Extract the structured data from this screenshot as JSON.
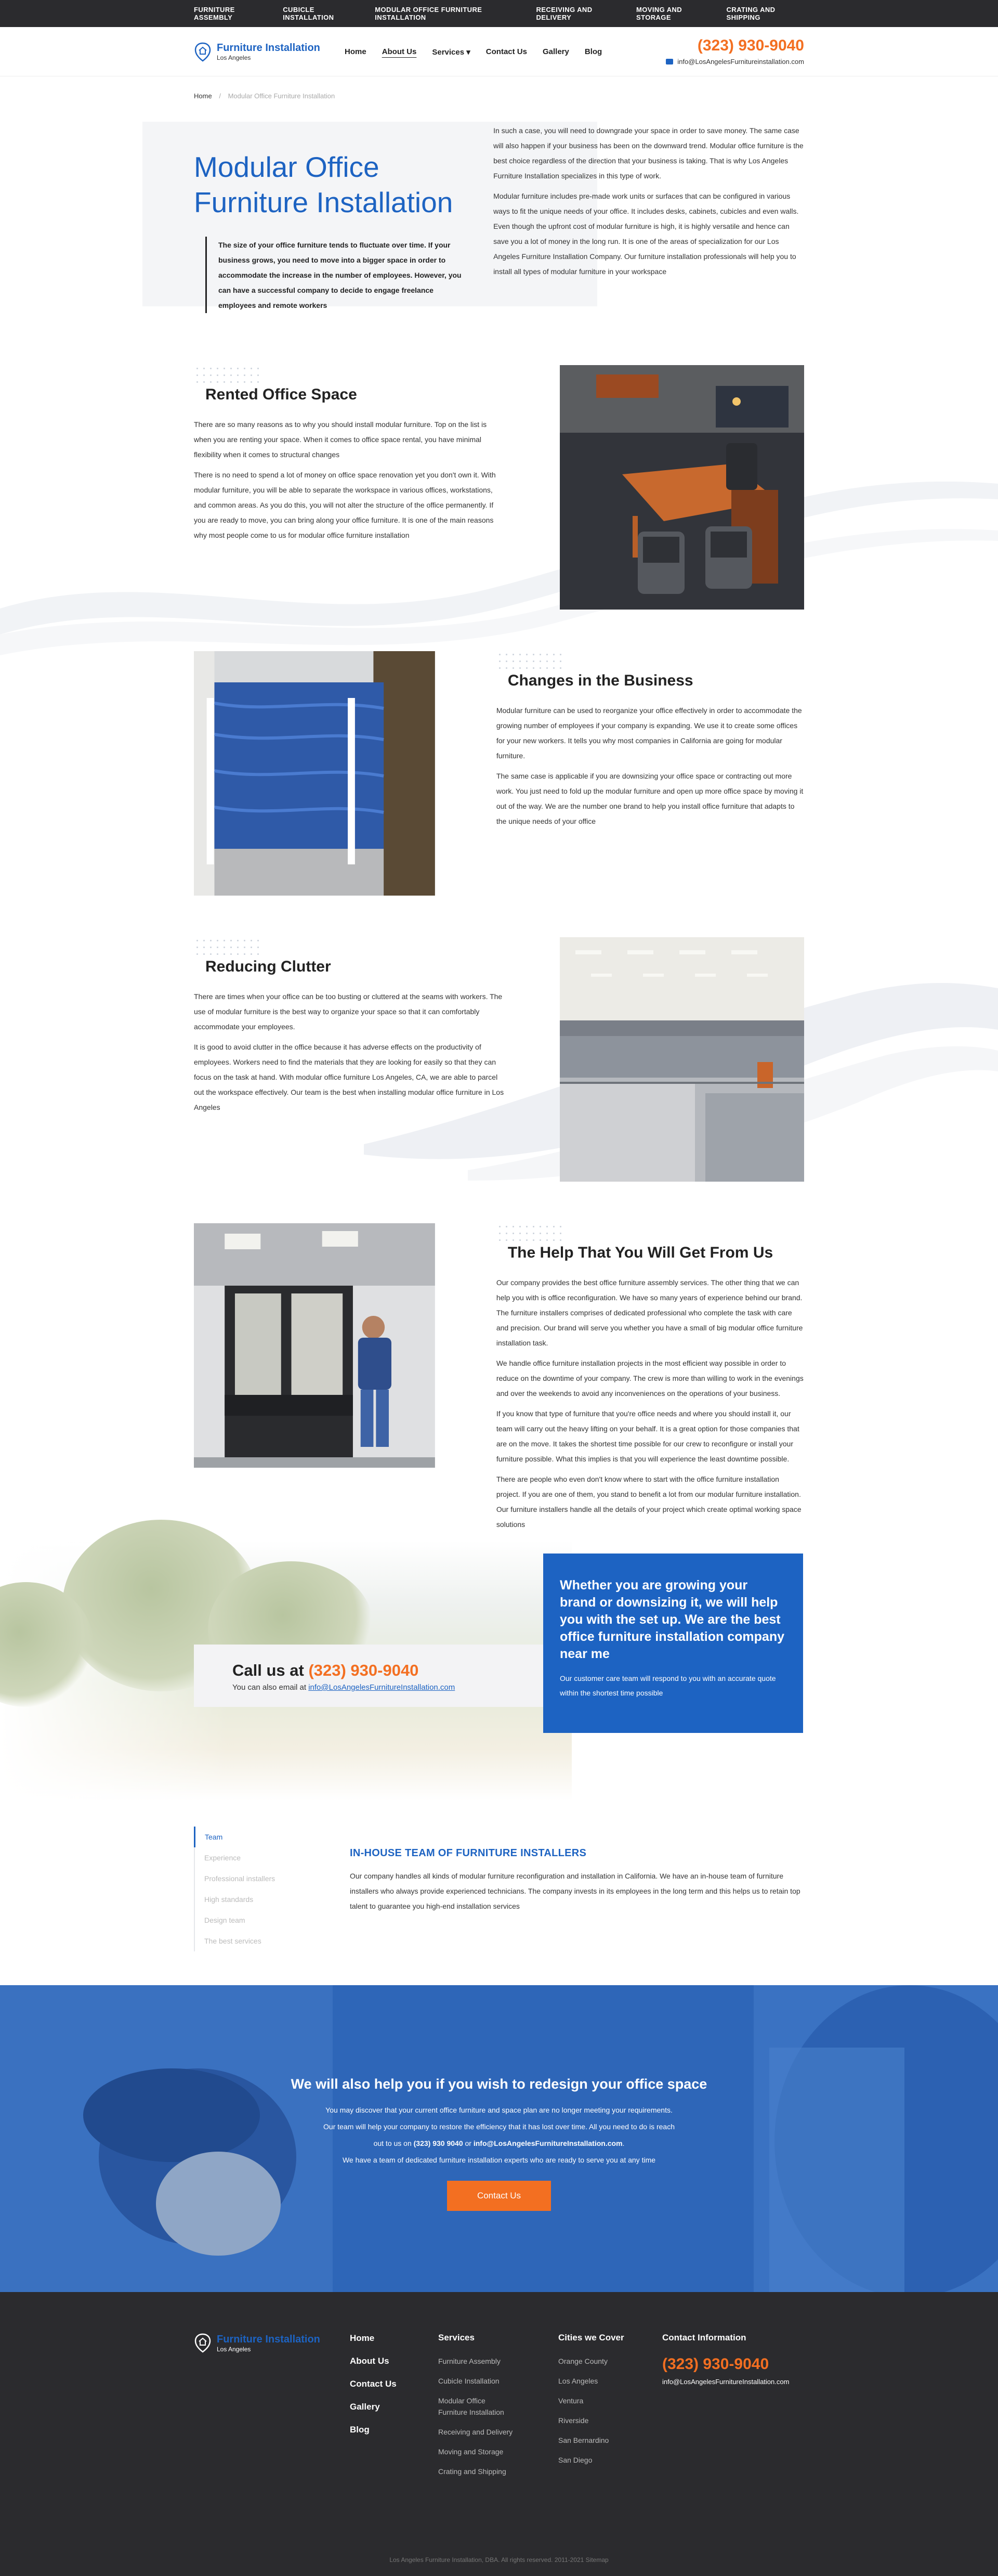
{
  "topbar": [
    "FURNITURE ASSEMBLY",
    "CUBICLE INSTALLATION",
    "MODULAR OFFICE FURNITURE INSTALLATION",
    "RECEIVING AND DELIVERY",
    "MOVING AND STORAGE",
    "CRATING AND SHIPPING"
  ],
  "header": {
    "logo_title": "Furniture Installation",
    "logo_sub": "Los Angeles",
    "nav": [
      "Home",
      "About Us",
      "Services",
      "Contact Us",
      "Gallery",
      "Blog"
    ],
    "phone": "(323) 930-9040",
    "email": "info@LosAngelesFurnitureinstallation.com"
  },
  "breadcrumb": {
    "home": "Home",
    "current": "Modular Office Furniture Installation"
  },
  "hero": {
    "title": "Modular Office Furniture Installation",
    "quote": "The size of your office furniture tends to fluctuate over time. If your business grows, you need to move into a bigger space in order to accommodate the increase in the number of employees. However, you can have a successful company to decide to engage freelance employees and remote workers",
    "p1": "In such a case, you will need to downgrade your space in order to save money. The same case will also happen if your business has been on the downward trend. Modular office furniture is the best choice regardless of the direction that your business is taking. That is why Los Angeles Furniture Installation specializes in this type of work.",
    "p2": "Modular furniture includes pre-made work units or surfaces that can be configured in various ways to fit the unique needs of your office. It includes desks, cabinets, cubicles and even walls. Even though the upfront cost of modular furniture is high, it is highly versatile and hence can save you a lot of money in the long run. It is one of the areas of specialization for our Los Angeles Furniture Installation Company. Our furniture installation professionals will help you to install all types of modular furniture in your workspace"
  },
  "sections": [
    {
      "title": "Rented Office Space",
      "p1": "There are so many reasons as to why you should install modular furniture. Top on the list is when you are renting your space. When it comes to office space rental, you have minimal flexibility when it comes to structural changes",
      "p2": "There is no need to spend a lot of money on office space renovation yet you don't own it. With modular furniture, you will be able to separate the workspace in various offices, workstations, and common areas. As you do this, you will not alter the structure of the office permanently. If you are ready to move, you can bring along your office furniture. It is one of the main reasons why most people come to us for modular office furniture installation"
    },
    {
      "title": "Changes in the Business",
      "p1": "Modular furniture can be used to reorganize your office effectively in order to accommodate the growing number of employees if your company is expanding. We use it to create some offices for your new workers. It tells you why most companies in California are going for modular furniture.",
      "p2": "The same case is applicable if you are downsizing your office space or contracting out more work. You just need to fold up the modular furniture and open up more office space by moving it out of the way. We are the number one brand to help you install office furniture that adapts to the unique needs of your office"
    },
    {
      "title": "Reducing Clutter",
      "p1": "There are times when your office can be too busting or cluttered at the seams with workers. The use of modular furniture is the best way to organize your space so that it can comfortably accommodate your employees.",
      "p2": "It is good to avoid clutter in the office because it has adverse effects on the productivity of employees. Workers need to find the materials that they are looking for easily so that they can focus on the task at hand. With modular office furniture Los Angeles, CA, we are able to parcel out the workspace effectively. Our team is the best when installing modular office furniture in Los Angeles"
    },
    {
      "title": "The Help That You Will Get From Us",
      "p1": "Our company provides the best office furniture assembly services. The other thing that we can help you with is office reconfiguration. We have so many years of experience behind our brand. The furniture installers comprises of dedicated professional who complete the task with care and precision. Our brand will serve you whether you have a small of big modular office furniture installation task.",
      "p2": "We handle office furniture installation projects in the most efficient way possible in order to reduce on the downtime of your company. The crew is more than willing to work in the evenings and over the weekends to avoid any inconveniences on the operations of your business.",
      "p3": "If you know that type of furniture that you're office needs and where you should install it, our team will carry out the heavy lifting on your behalf. It is a great option for those companies that are on the move. It takes the shortest time possible for our crew to reconfigure or install your furniture possible. What this implies is that you will experience the least downtime possible.",
      "p4": "There are people who even don't know where to start with the office furniture installation project. If you are one of them, you stand to benefit a lot from our modular furniture installation. Our furniture installers handle all the details of your project which create optimal working space solutions"
    }
  ],
  "cta": {
    "blue_title": "Whether you are growing your brand or downsizing it, we will help you with the set up. We are the best office furniture installation company near me",
    "blue_text": "Our customer care team will respond to you with an accurate quote within the shortest time possible",
    "call_prefix": "Call us at ",
    "call_phone": "(323) 930-9040",
    "email_prefix": "You can also email at ",
    "email": "info@LosAngelesFurnitureInstallation.com"
  },
  "tabs": {
    "items": [
      "Team",
      "Experience",
      "Professional installers",
      "High standards",
      "Design team",
      "The best services"
    ],
    "title": "IN-HOUSE TEAM OF FURNITURE INSTALLERS",
    "text": "Our company handles all kinds of modular furniture reconfiguration and installation in California. We have an in-house team of furniture installers who always provide experienced technicians. The company invests in its employees in the long term and this helps us to retain top talent to guarantee you high-end installation services"
  },
  "banner": {
    "title": "We will also help you if you wish to redesign your office space",
    "l1": "You may discover that your current office furniture and space plan are no longer meeting your requirements.",
    "l2": "Our team will help your company to restore the efficiency that it has lost over time. All you need to do is reach",
    "l3_pre": "out to us on ",
    "l3_phone": "(323) 930 9040",
    "l3_mid": " or ",
    "l3_mail": "info@LosAngelesFurnitureInstallation.com",
    "l3_end": ".",
    "l4": "We have a team of dedicated furniture installation experts who are ready to serve you at any time",
    "button": "Contact Us"
  },
  "footer": {
    "logo_title": "Furniture Installation",
    "logo_sub": "Los Angeles",
    "nav": [
      "Home",
      "About Us",
      "Contact Us",
      "Gallery",
      "Blog"
    ],
    "services_title": "Services",
    "services": [
      "Furniture Assembly",
      "Cubicle Installation",
      "Modular Office Furniture Installation",
      "Receiving and Delivery",
      "Moving and Storage",
      "Crating and Shipping"
    ],
    "cities_title": "Cities we Cover",
    "cities": [
      "Orange County",
      "Los Angeles",
      "Ventura",
      "Riverside",
      "San Bernardino",
      "San Diego"
    ],
    "contact_title": "Contact Information",
    "phone": "(323) 930-9040",
    "email": "info@LosAngelesFurnitureInstallation.com",
    "copyright": "Los Angeles Furniture Installation, DBA. All rights reserved. 2011-2021 Sitemap"
  },
  "colors": {
    "brand_blue": "#1d63c2",
    "accent_orange": "#f36f21",
    "dark": "#2b2b2e"
  }
}
